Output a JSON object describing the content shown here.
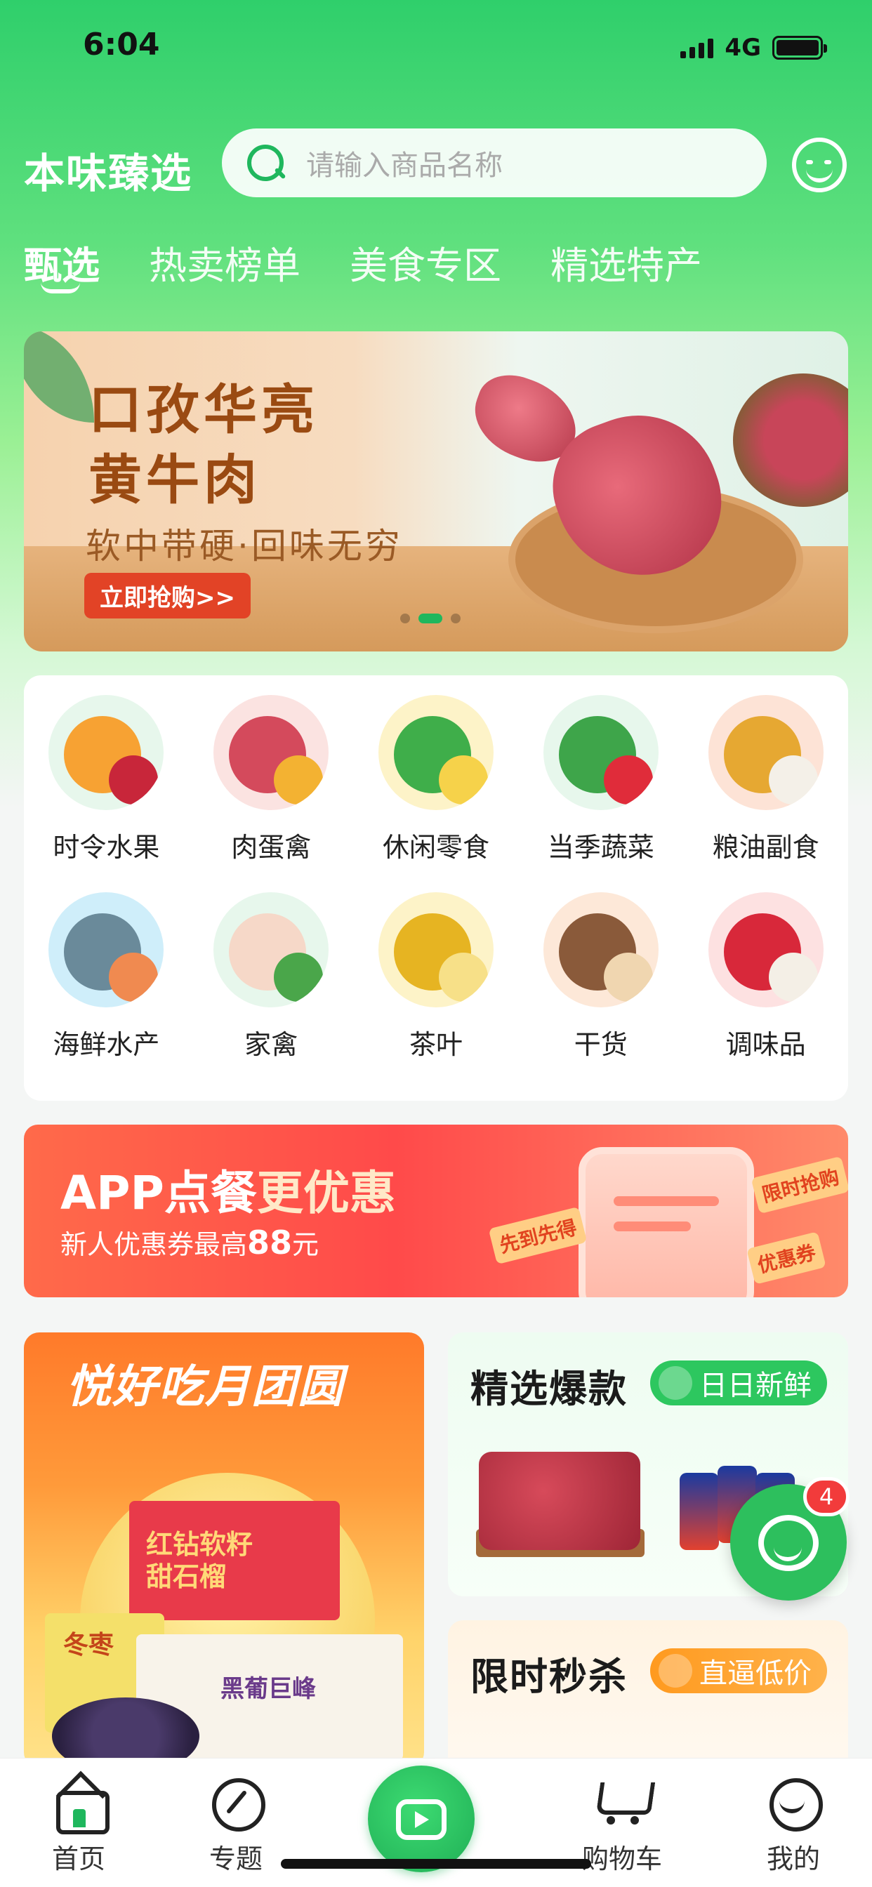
{
  "status_bar": {
    "time": "6:04",
    "network": "4G"
  },
  "header": {
    "brand": "本味臻选",
    "search_placeholder": "请输入商品名称"
  },
  "tabs": [
    {
      "label": "甄选",
      "active": true
    },
    {
      "label": "热卖榜单",
      "active": false
    },
    {
      "label": "美食专区",
      "active": false
    },
    {
      "label": "精选特产",
      "active": false
    }
  ],
  "banner": {
    "title_line1": "口孜华亮",
    "title_line2": "黄牛肉",
    "subtitle": "软中带硬·回味无穷",
    "cta": "立即抢购>>",
    "slide_count": 3,
    "active_slide": 2
  },
  "categories": [
    {
      "label": "时令水果",
      "icon": "fruit-icon",
      "colors": [
        "#f7a233",
        "#c8263a",
        "#e7f7ec"
      ]
    },
    {
      "label": "肉蛋禽",
      "icon": "meat-icon",
      "colors": [
        "#d44a5c",
        "#f3b232",
        "#fbe3e1"
      ]
    },
    {
      "label": "休闲零食",
      "icon": "snack-icon",
      "colors": [
        "#3fae4a",
        "#f6d24a",
        "#fdf3c8"
      ]
    },
    {
      "label": "当季蔬菜",
      "icon": "vegetable-icon",
      "colors": [
        "#3ea54a",
        "#e02c3a",
        "#e7f7ec"
      ]
    },
    {
      "label": "粮油副食",
      "icon": "grain-oil-icon",
      "colors": [
        "#e6a832",
        "#f4f0e8",
        "#fde3d6"
      ]
    },
    {
      "label": "海鲜水产",
      "icon": "seafood-icon",
      "colors": [
        "#6a8a9a",
        "#f08a50",
        "#cfeefa"
      ]
    },
    {
      "label": "家禽",
      "icon": "poultry-icon",
      "colors": [
        "#f6d8c8",
        "#4aa64a",
        "#e7f7ec"
      ]
    },
    {
      "label": "茶叶",
      "icon": "tea-icon",
      "colors": [
        "#e6b422",
        "#f7e088",
        "#fdf3c8"
      ]
    },
    {
      "label": "干货",
      "icon": "dried-goods-icon",
      "colors": [
        "#8a5a3a",
        "#f0d6b0",
        "#fde8d8"
      ]
    },
    {
      "label": "调味品",
      "icon": "seasoning-icon",
      "colors": [
        "#d8283a",
        "#f4efe6",
        "#fde1e1"
      ]
    }
  ],
  "promo": {
    "title_prefix": "APP点餐",
    "title_highlight": "更优惠",
    "subtitle_prefix": "新人优惠券最高",
    "amount": "88",
    "subtitle_suffix": "元",
    "tags": [
      "先到先得",
      "限时抢购",
      "优惠券"
    ]
  },
  "moon_card": {
    "title": "悦好吃月团圆",
    "box_text1": "红钻软籽",
    "box_text2": "甜石榴",
    "box2_text": "冬枣",
    "box3_text": "黑葡巨峰"
  },
  "hot_card": {
    "title": "精选爆款",
    "tag": "日日新鲜"
  },
  "flash_card": {
    "title": "限时秒杀",
    "tag": "直逼低价"
  },
  "floating_chat": {
    "badge": "4"
  },
  "bottom_nav": [
    {
      "label": "首页",
      "icon": "home-icon",
      "active": true
    },
    {
      "label": "专题",
      "icon": "topic-icon",
      "active": false
    },
    {
      "label": "",
      "icon": "video-icon",
      "active": false
    },
    {
      "label": "购物车",
      "icon": "cart-icon",
      "active": false
    },
    {
      "label": "我的",
      "icon": "profile-icon",
      "active": false
    }
  ],
  "colors": {
    "brand_green": "#1fb75d",
    "header_green": "#2fcf6b",
    "promo_red": "#ff4a4a",
    "badge_red": "#f23b3b"
  }
}
